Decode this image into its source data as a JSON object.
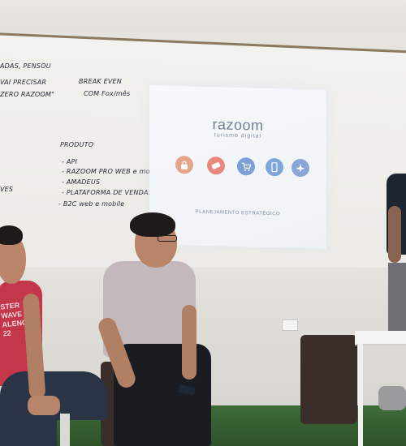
{
  "whiteboard": {
    "notes": [
      "ADAS, PENSOU",
      "VAI PRECISAR",
      "ZERO RAZOOM\"",
      "BREAK EVEN",
      "COM Fox/mês",
      "PRODUTO",
      "- API",
      "- RAZOOM PRO WEB e mobile",
      "- AMADEUS",
      "- PLATAFORMA DE VENDAS",
      "- B2C web e mobile",
      "VES"
    ]
  },
  "slide": {
    "logo": "razoom",
    "tagline": "turismo digital",
    "subtitle": "PLANEJAMENTO ESTRATÉGICO",
    "icons": [
      {
        "name": "lock-icon",
        "glyph": "🔒",
        "color": "#e8a48b"
      },
      {
        "name": "ticket-icon",
        "glyph": "◈",
        "color": "#e7877d"
      },
      {
        "name": "cart-icon",
        "glyph": "🛒",
        "color": "#7d9fd8"
      },
      {
        "name": "mobile-icon",
        "glyph": "▯",
        "color": "#7fa8d9"
      },
      {
        "name": "plane-icon",
        "glyph": "✈",
        "color": "#8aa6d6"
      }
    ]
  },
  "people": {
    "left_shirt_text": [
      "STER",
      "WAVE",
      "ALENO",
      "22"
    ]
  }
}
